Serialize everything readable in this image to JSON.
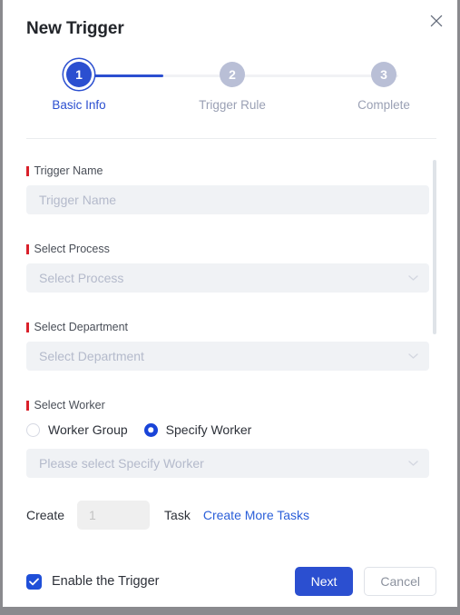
{
  "dialog": {
    "title": "New Trigger",
    "close_icon": "close-icon"
  },
  "stepper": {
    "steps": [
      {
        "number": "1",
        "label": "Basic Info",
        "state": "active"
      },
      {
        "number": "2",
        "label": "Trigger Rule",
        "state": "inactive"
      },
      {
        "number": "3",
        "label": "Complete",
        "state": "inactive"
      }
    ],
    "active_color": "#2b4fd0",
    "inactive_color": "#b9bfd6"
  },
  "form": {
    "trigger_name": {
      "label": "Trigger Name",
      "required": true,
      "value": "",
      "placeholder": "Trigger Name"
    },
    "select_process": {
      "label": "Select Process",
      "required": true,
      "value": "",
      "placeholder": "Select Process",
      "icon": "chevron-down-icon"
    },
    "select_department": {
      "label": "Select Department",
      "required": true,
      "value": "",
      "placeholder": "Select Department",
      "icon": "chevron-down-icon"
    },
    "select_worker": {
      "label": "Select Worker",
      "required": true,
      "options": [
        {
          "label": "Worker Group",
          "selected": false
        },
        {
          "label": "Specify Worker",
          "selected": true
        }
      ],
      "value": "",
      "placeholder": "Please select Specify Worker",
      "icon": "chevron-down-icon"
    },
    "create_tasks": {
      "prefix_label": "Create",
      "count_value": "",
      "count_placeholder": "1",
      "suffix_label": "Task",
      "link_label": "Create More Tasks"
    }
  },
  "footer": {
    "enable_checkbox": {
      "label": "Enable the Trigger",
      "checked": true,
      "icon": "check-icon"
    },
    "next_label": "Next",
    "cancel_label": "Cancel",
    "primary_color": "#2b4fd0"
  }
}
